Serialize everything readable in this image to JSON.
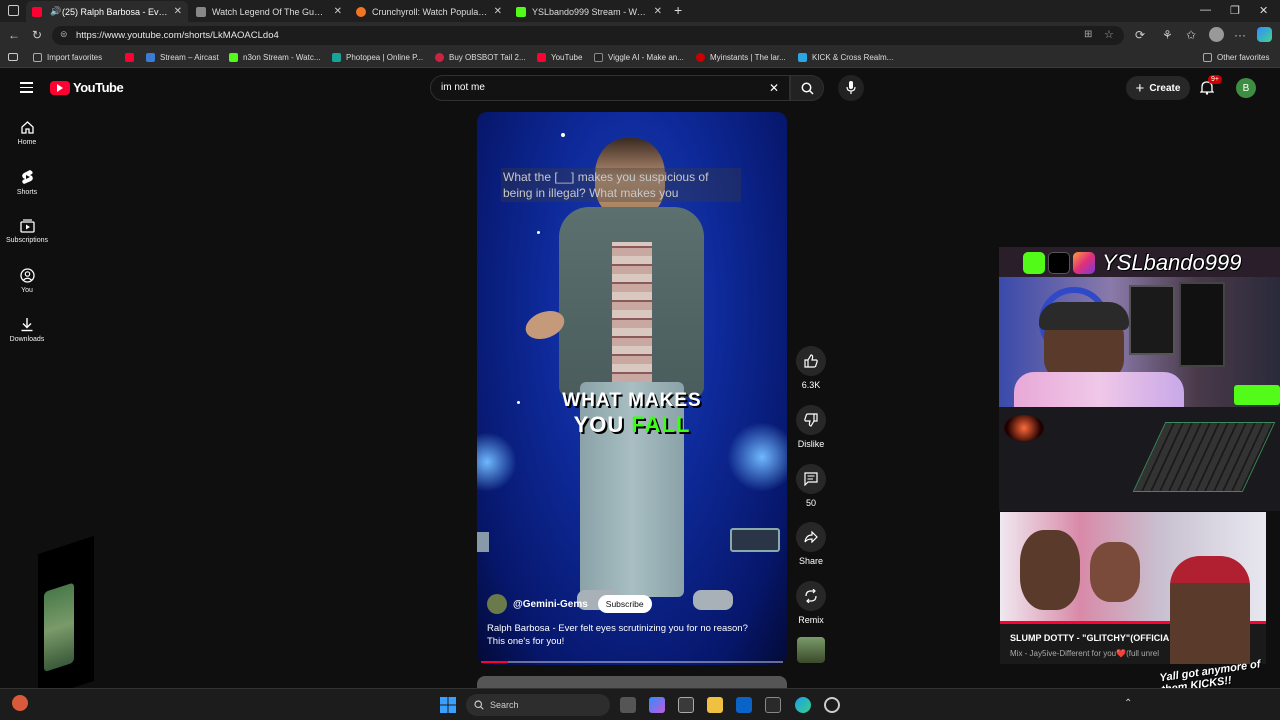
{
  "browser": {
    "tabs": [
      {
        "label": "(25) Ralph Barbosa - Ever fel",
        "active": true,
        "color": "#ff0033"
      },
      {
        "label": "Watch Legend Of The Guardians:",
        "active": false,
        "color": "#888888"
      },
      {
        "label": "Crunchyroll: Watch Popular Anim",
        "active": false,
        "color": "#f47521"
      },
      {
        "label": "YSLbando999 Stream - Watch Liv",
        "active": false,
        "color": "#53fc18"
      }
    ],
    "new_tab": "+",
    "url": "https://www.youtube.com/shorts/LkMAOACLdo4",
    "favorites": [
      {
        "label": "Import favorites",
        "color": "#888888"
      },
      {
        "label": "",
        "color": "#ff0033"
      },
      {
        "label": "Stream – Aircast",
        "color": "#3a7bd5"
      },
      {
        "label": "n3on Stream - Watc...",
        "color": "#53fc18"
      },
      {
        "label": "Photopea | Online P...",
        "color": "#18a497"
      },
      {
        "label": "Buy OBSBOT Tail 2...",
        "color": "#cc2244"
      },
      {
        "label": "YouTube",
        "color": "#ff0033"
      },
      {
        "label": "Viggle AI - Make an...",
        "color": "#222222"
      },
      {
        "label": "Myinstants | The lar...",
        "color": "#cc0000"
      },
      {
        "label": "KICK & Cross Realm...",
        "color": "#2aa6e0"
      }
    ],
    "other_favorites": "Other favorites"
  },
  "youtube": {
    "logo": "YouTube",
    "search_value": "im not me",
    "create_label": "Create",
    "notif_count": "9+",
    "avatar_letter": "B",
    "nav": [
      {
        "label": "Home",
        "icon": "home-icon"
      },
      {
        "label": "Shorts",
        "icon": "shorts-icon"
      },
      {
        "label": "Subscriptions",
        "icon": "subscriptions-icon"
      },
      {
        "label": "You",
        "icon": "you-icon"
      },
      {
        "label": "Downloads",
        "icon": "download-icon"
      }
    ]
  },
  "short": {
    "caption_top": "What the [__] makes you suspicious of being in illegal? What makes you",
    "subtitle_line1": "WHAT MAKES",
    "subtitle_line2_white": "YOU",
    "subtitle_line2_green": "FALL",
    "channel": "@Gemini-Gems",
    "subscribe": "Subscribe",
    "description": "Ralph Barbosa - Ever felt eyes scrutinizing you for no reason? This one's for you!",
    "progress": 0.09,
    "actions": {
      "likes": "6.3K",
      "dislike": "Dislike",
      "comments": "50",
      "share": "Share",
      "remix": "Remix"
    }
  },
  "overlay": {
    "streamer_name": "YSLbando999",
    "music_title": "SLUMP DOTTY - \"GLITCHY\"(OFFICIA",
    "music_sub": "Mix - Jay5ive-Different for you❤️(full unrel",
    "quote": "Yall got anymore of them KICKS!!"
  },
  "taskbar": {
    "search_placeholder": "Search"
  }
}
